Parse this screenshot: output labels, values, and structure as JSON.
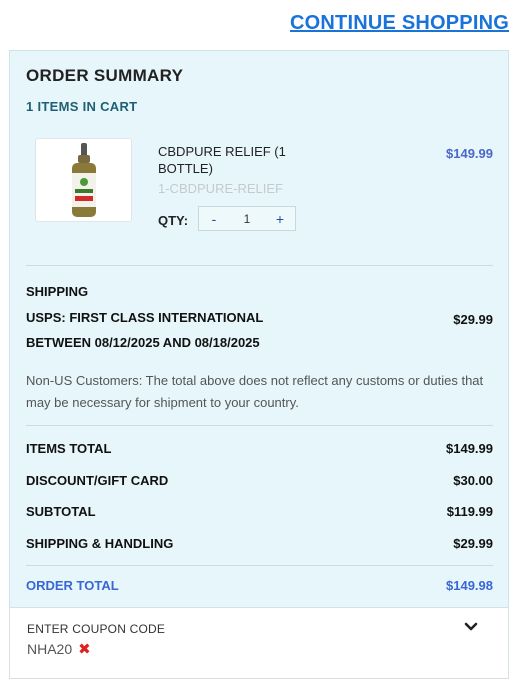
{
  "header": {
    "continue_link": "CONTINUE SHOPPING"
  },
  "summary": {
    "title": "ORDER SUMMARY",
    "items_count": "1 ITEMS IN CART",
    "product": {
      "name": "CBDPURE RELIEF (1 BOTTLE)",
      "sku": "1-CBDPURE-RELIEF",
      "price": "$149.99",
      "qty_label": "QTY:",
      "qty_value": "1",
      "qty_minus": "-",
      "qty_plus": "+"
    },
    "shipping": {
      "heading": "SHIPPING",
      "method": "USPS: FIRST CLASS INTERNATIONAL",
      "method_price": "$29.99",
      "dates": "BETWEEN 08/12/2025 AND 08/18/2025",
      "notice": "Non-US Customers: The total above does not reflect any customs or duties that may be necessary for shipment to your country."
    },
    "totals": [
      {
        "label": "ITEMS TOTAL",
        "value": "$149.99"
      },
      {
        "label": "DISCOUNT/GIFT CARD",
        "value": "$30.00"
      },
      {
        "label": "SUBTOTAL",
        "value": "$119.99"
      },
      {
        "label": "SHIPPING & HANDLING",
        "value": "$29.99"
      }
    ],
    "order_total": {
      "label": "ORDER TOTAL",
      "value": "$149.98"
    }
  },
  "coupon": {
    "label": "ENTER COUPON CODE",
    "code": "NHA20",
    "remove_icon": "close-icon",
    "chevron_icon": "chevron-down-icon"
  },
  "colors": {
    "link": "#1a73d9",
    "panel_bg": "#e6f6fb",
    "price": "#4a67c9",
    "accent_total": "#3a66d6",
    "remove": "#e02020"
  }
}
